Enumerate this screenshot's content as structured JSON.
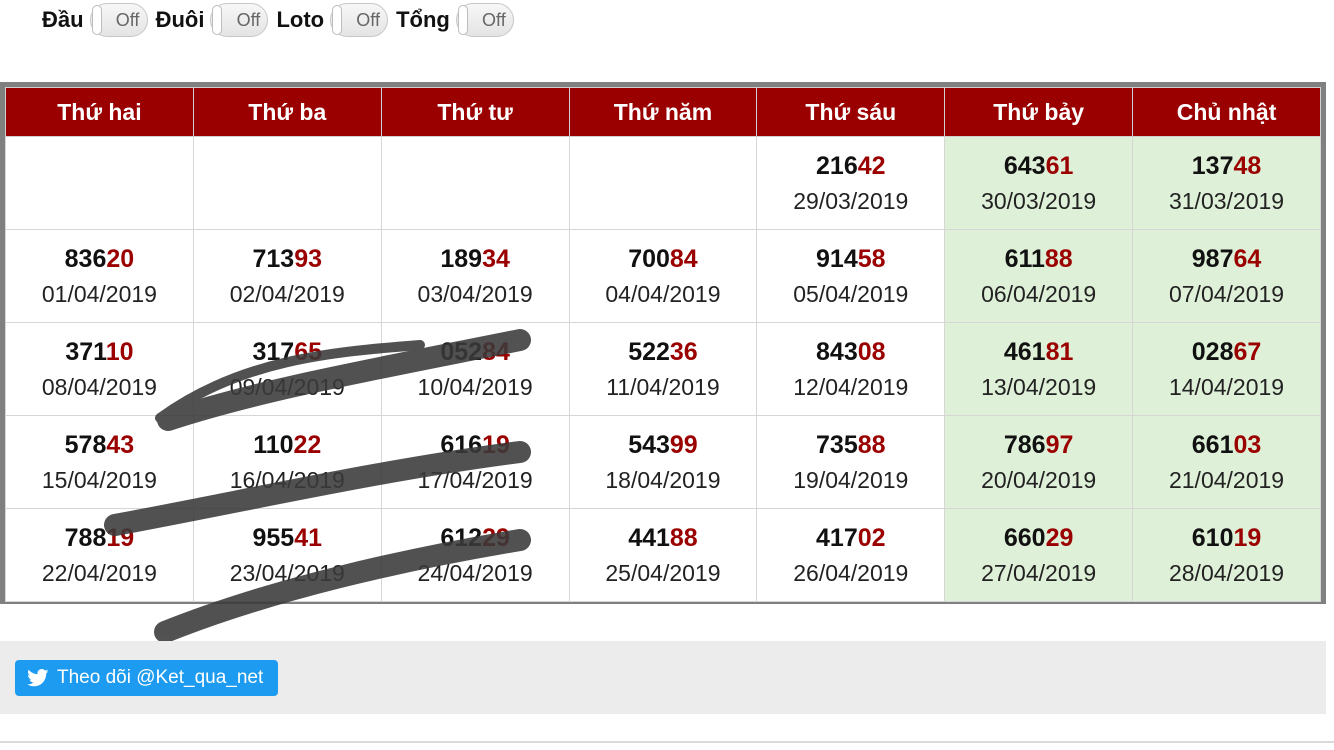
{
  "toggles": [
    {
      "label": "Đầu",
      "state": "Off"
    },
    {
      "label": "Đuôi",
      "state": "Off"
    },
    {
      "label": "Loto",
      "state": "Off"
    },
    {
      "label": "Tổng",
      "state": "Off"
    }
  ],
  "calendar": {
    "headers": [
      "Thứ hai",
      "Thứ ba",
      "Thứ tư",
      "Thứ năm",
      "Thứ sáu",
      "Thứ bảy",
      "Chủ nhật"
    ],
    "rows": [
      [
        null,
        null,
        null,
        null,
        {
          "head": "216",
          "tail": "42",
          "date": "29/03/2019"
        },
        {
          "head": "643",
          "tail": "61",
          "date": "30/03/2019"
        },
        {
          "head": "137",
          "tail": "48",
          "date": "31/03/2019"
        }
      ],
      [
        {
          "head": "836",
          "tail": "20",
          "date": "01/04/2019"
        },
        {
          "head": "713",
          "tail": "93",
          "date": "02/04/2019"
        },
        {
          "head": "189",
          "tail": "34",
          "date": "03/04/2019"
        },
        {
          "head": "700",
          "tail": "84",
          "date": "04/04/2019"
        },
        {
          "head": "914",
          "tail": "58",
          "date": "05/04/2019"
        },
        {
          "head": "611",
          "tail": "88",
          "date": "06/04/2019"
        },
        {
          "head": "987",
          "tail": "64",
          "date": "07/04/2019"
        }
      ],
      [
        {
          "head": "371",
          "tail": "10",
          "date": "08/04/2019"
        },
        {
          "head": "317",
          "tail": "65",
          "date": "09/04/2019"
        },
        {
          "head": "052",
          "tail": "84",
          "date": "10/04/2019"
        },
        {
          "head": "522",
          "tail": "36",
          "date": "11/04/2019"
        },
        {
          "head": "843",
          "tail": "08",
          "date": "12/04/2019"
        },
        {
          "head": "461",
          "tail": "81",
          "date": "13/04/2019"
        },
        {
          "head": "028",
          "tail": "67",
          "date": "14/04/2019"
        }
      ],
      [
        {
          "head": "578",
          "tail": "43",
          "date": "15/04/2019"
        },
        {
          "head": "110",
          "tail": "22",
          "date": "16/04/2019"
        },
        {
          "head": "616",
          "tail": "19",
          "date": "17/04/2019"
        },
        {
          "head": "543",
          "tail": "99",
          "date": "18/04/2019"
        },
        {
          "head": "735",
          "tail": "88",
          "date": "19/04/2019"
        },
        {
          "head": "786",
          "tail": "97",
          "date": "20/04/2019"
        },
        {
          "head": "661",
          "tail": "03",
          "date": "21/04/2019"
        }
      ],
      [
        {
          "head": "788",
          "tail": "19",
          "date": "22/04/2019"
        },
        {
          "head": "955",
          "tail": "41",
          "date": "23/04/2019"
        },
        {
          "head": "612",
          "tail": "29",
          "date": "24/04/2019"
        },
        {
          "head": "441",
          "tail": "88",
          "date": "25/04/2019"
        },
        {
          "head": "417",
          "tail": "02",
          "date": "26/04/2019"
        },
        {
          "head": "660",
          "tail": "29",
          "date": "27/04/2019"
        },
        {
          "head": "610",
          "tail": "19",
          "date": "28/04/2019"
        }
      ]
    ]
  },
  "follow_button": {
    "label": "Theo dõi @Ket_qua_net",
    "icon": "twitter-bird-icon"
  },
  "colors": {
    "header_bg": "#9b0000",
    "tail_digits": "#9b0000",
    "weekend_bg": "#dff0d8",
    "twitter_blue": "#1d9bf0"
  }
}
